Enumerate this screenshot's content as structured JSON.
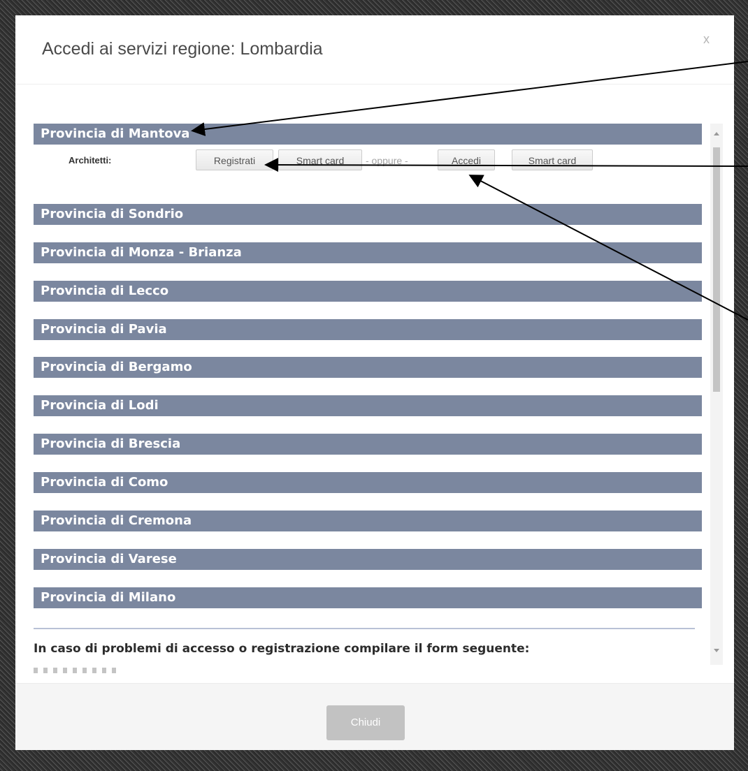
{
  "modal": {
    "title": "Accedi ai servizi regione: Lombardia",
    "close_label": "x",
    "close_button_label": "Chiudi"
  },
  "provinces": [
    "Provincia di Mantova",
    "Provincia di Sondrio",
    "Provincia di Monza - Brianza",
    "Provincia di Lecco",
    "Provincia di Pavia",
    "Provincia di Bergamo",
    "Provincia di Lodi",
    "Provincia di Brescia",
    "Provincia di Como",
    "Provincia di Cremona",
    "Provincia di Varese",
    "Provincia di Milano"
  ],
  "architetti_row": {
    "label": "Architetti:",
    "register_label": "Registrati",
    "register_smartcard_label": "Smart card",
    "separator_text": "- oppure -",
    "login_label": "Accedi",
    "login_smartcard_label": "Smart card"
  },
  "problem_text": "In caso di problemi di accesso o registrazione compilare il form seguente:",
  "colors": {
    "province_bar": "#7b879f",
    "arrow": "#000000"
  }
}
